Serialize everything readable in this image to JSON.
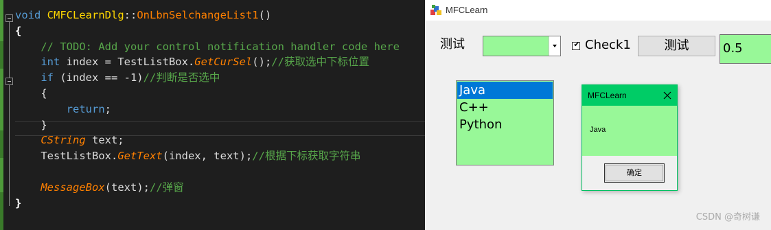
{
  "editor": {
    "lines": [
      [
        {
          "t": "void ",
          "c": "t-kw"
        },
        {
          "t": "CMFCLearnDlg",
          "c": "t-cls"
        },
        {
          "t": "::",
          "c": "t-pun"
        },
        {
          "t": "OnLbnSelchangeList1",
          "c": "t-fn"
        },
        {
          "t": "()",
          "c": "t-pun"
        }
      ],
      [
        {
          "t": "{",
          "c": "t-brace"
        }
      ],
      [
        {
          "t": "    // TODO: Add your control notification handler code here",
          "c": "t-cm"
        }
      ],
      [
        {
          "t": "    ",
          "c": "t-pun"
        },
        {
          "t": "int ",
          "c": "t-kw"
        },
        {
          "t": "index = TestListBox.",
          "c": "t-var"
        },
        {
          "t": "GetCurSel",
          "c": "t-mfn"
        },
        {
          "t": "();",
          "c": "t-pun"
        },
        {
          "t": "//获取选中下标位置",
          "c": "t-cm"
        }
      ],
      [
        {
          "t": "    ",
          "c": "t-pun"
        },
        {
          "t": "if ",
          "c": "t-kw"
        },
        {
          "t": "(index == -1)",
          "c": "t-var"
        },
        {
          "t": "//判断是否选中",
          "c": "t-cm"
        }
      ],
      [
        {
          "t": "    {",
          "c": "t-pun"
        }
      ],
      [
        {
          "t": "        ",
          "c": "t-pun"
        },
        {
          "t": "return",
          "c": "t-kw"
        },
        {
          "t": ";",
          "c": "t-pun"
        }
      ],
      [
        {
          "t": "    }",
          "c": "t-pun"
        }
      ],
      [
        {
          "t": "    ",
          "c": "t-pun"
        },
        {
          "t": "CString ",
          "c": "t-mfn"
        },
        {
          "t": "text;",
          "c": "t-var"
        }
      ],
      [
        {
          "t": "    TestListBox.",
          "c": "t-var"
        },
        {
          "t": "GetText",
          "c": "t-mfn"
        },
        {
          "t": "(index, text);",
          "c": "t-var"
        },
        {
          "t": "//根据下标获取字符串",
          "c": "t-cm"
        }
      ],
      [
        {
          "t": "",
          "c": "t-pun"
        }
      ],
      [
        {
          "t": "    ",
          "c": "t-pun"
        },
        {
          "t": "MessageBox",
          "c": "t-mfn"
        },
        {
          "t": "(text);",
          "c": "t-var"
        },
        {
          "t": "//弹窗",
          "c": "t-cm"
        }
      ],
      [
        {
          "t": "}",
          "c": "t-brace"
        }
      ]
    ]
  },
  "app": {
    "title": "MFCLearn",
    "label_test": "测试",
    "combo_value": "",
    "check_label": "Check1",
    "checked": "✔",
    "button_test": "测试",
    "edit_value": "0.5",
    "list_items": [
      "Java",
      "C++",
      "Python"
    ],
    "selected_index": 0,
    "colors": {
      "control_bg": "#98f898",
      "selection": "#0078d7",
      "msgbox_title": "#00cc66"
    }
  },
  "msgbox": {
    "title": "MFCLearn",
    "message": "Java",
    "ok_label": "确定"
  },
  "watermark": "CSDN @奇树谦"
}
